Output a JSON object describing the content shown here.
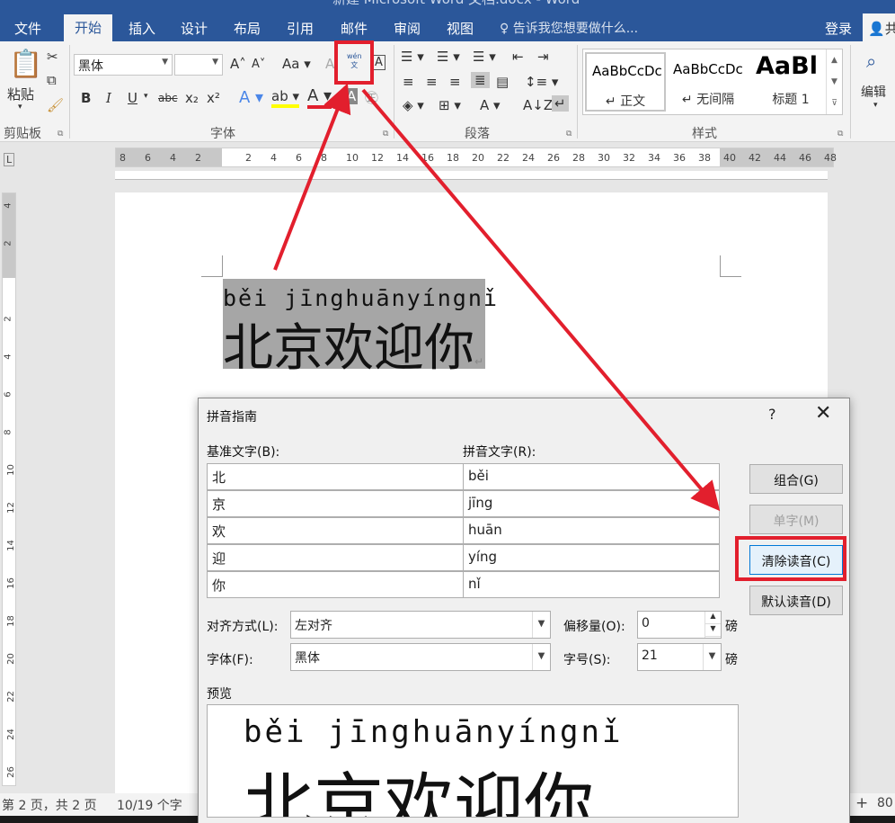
{
  "window": {
    "title": "新建 Microsoft Word 文档.docx - Word"
  },
  "tabs": [
    "文件",
    "开始",
    "插入",
    "设计",
    "布局",
    "引用",
    "邮件",
    "审阅",
    "视图"
  ],
  "active_tab": "开始",
  "tell_me": "告诉我您想要做什么...",
  "login": "登录",
  "share": "共",
  "ribbon": {
    "clipboard": {
      "paste": "粘贴",
      "label": "剪贴板"
    },
    "font": {
      "name": "黑体",
      "size": "",
      "label": "字体",
      "bold": "B",
      "italic": "I",
      "underline": "U",
      "strike": "abc",
      "sub": "x₂",
      "sup": "x²",
      "phonetic_guide": "wén\n文"
    },
    "paragraph": {
      "label": "段落"
    },
    "styles": {
      "label": "样式",
      "items": [
        {
          "preview": "AaBbCcDc",
          "name": "↵ 正文"
        },
        {
          "preview": "AaBbCcDc",
          "name": "↵ 无间隔"
        },
        {
          "preview": "AaBl",
          "name": "标题 1"
        }
      ]
    },
    "editing": {
      "label": "编辑"
    }
  },
  "ruler": {
    "ticks": [
      "8",
      "6",
      "4",
      "2",
      "",
      "2",
      "4",
      "6",
      "8",
      "10",
      "12",
      "14",
      "16",
      "18",
      "20",
      "22",
      "24",
      "26",
      "28",
      "30",
      "32",
      "34",
      "36",
      "38",
      "40",
      "42",
      "44",
      "46",
      "48"
    ],
    "vticks": [
      "4",
      "2",
      "",
      "2",
      "4",
      "6",
      "8",
      "10",
      "12",
      "14",
      "16",
      "18",
      "20",
      "22",
      "24",
      "26"
    ]
  },
  "document": {
    "pinyin": "běi jīnghuānyíngnǐ",
    "text": "北京欢迎你",
    "para_mark": "↵"
  },
  "status": {
    "page": "第 2 页，共 2 页",
    "words": "10/19 个字",
    "zoom": "80",
    "plus": "+"
  },
  "dialog": {
    "title": "拼音指南",
    "help": "?",
    "close": "✕",
    "base_label": "基准文字(B):",
    "ruby_label": "拼音文字(R):",
    "rows": [
      {
        "base": "北",
        "ruby": "běi"
      },
      {
        "base": "京",
        "ruby": "jīng"
      },
      {
        "base": "欢",
        "ruby": "huān"
      },
      {
        "base": "迎",
        "ruby": "yíng"
      },
      {
        "base": "你",
        "ruby": "nǐ"
      }
    ],
    "buttons": {
      "group": "组合(G)",
      "mono": "单字(M)",
      "clear": "清除读音(C)",
      "default": "默认读音(D)"
    },
    "alignment_label": "对齐方式(L):",
    "alignment_value": "左对齐",
    "offset_label": "偏移量(O):",
    "offset_value": "0",
    "font_label": "字体(F):",
    "font_value": "黑体",
    "size_label": "字号(S):",
    "size_value": "21",
    "unit": "磅",
    "preview_label": "预览",
    "preview_pinyin": "běi jīnghuānyíngnǐ",
    "preview_text": "北京欢迎你"
  },
  "colors": {
    "accent": "#2b579a",
    "highlight_red": "#e21f2d"
  }
}
